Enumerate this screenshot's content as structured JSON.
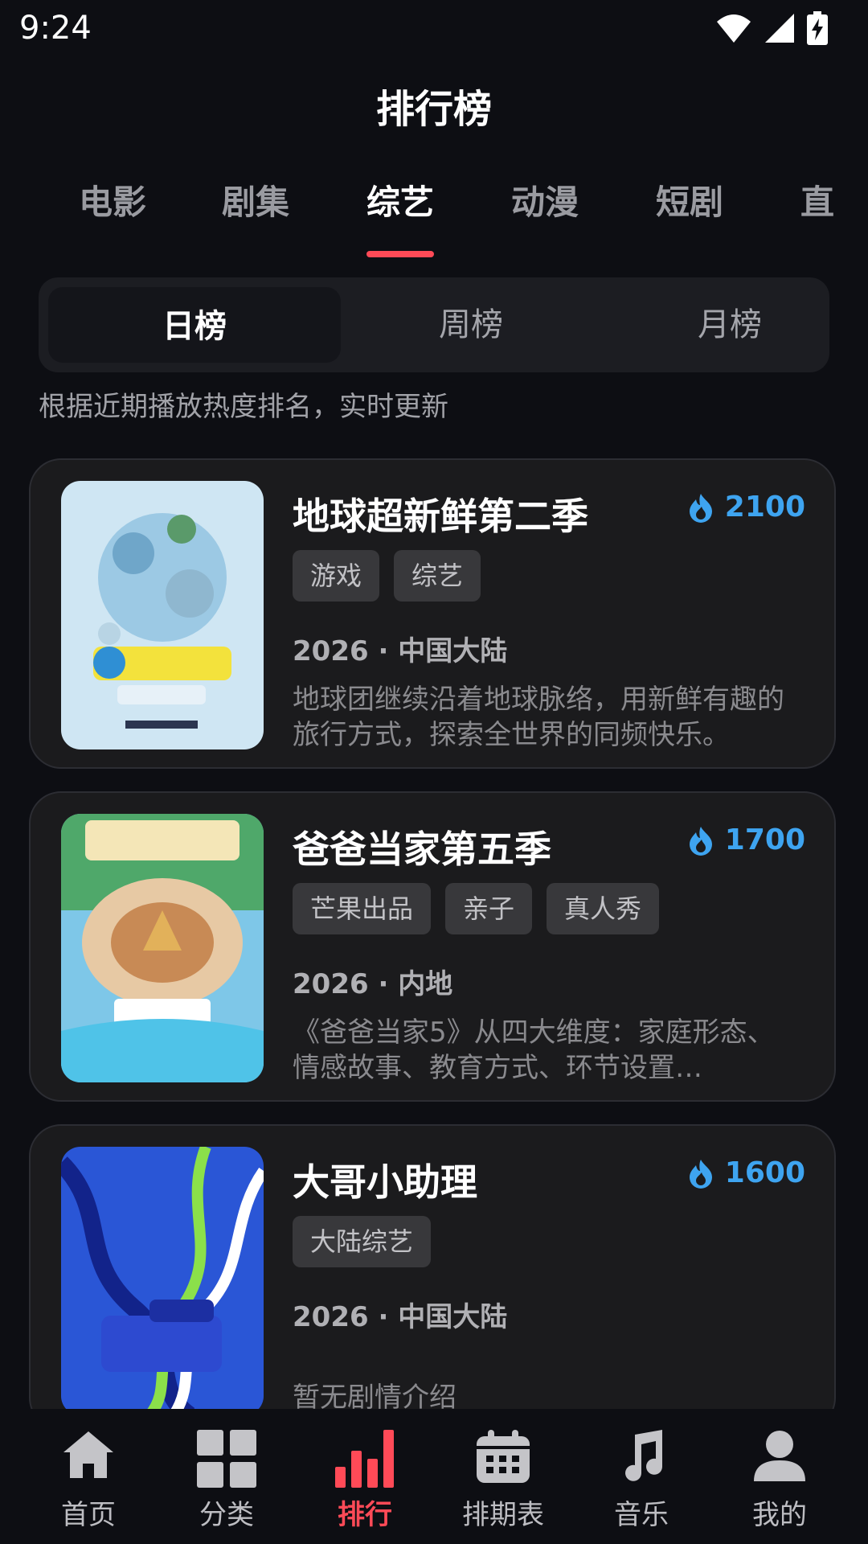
{
  "status": {
    "time": "9:24"
  },
  "header": {
    "title": "排行榜"
  },
  "tabs": [
    {
      "label": "电影"
    },
    {
      "label": "剧集"
    },
    {
      "label": "综艺",
      "active": true
    },
    {
      "label": "动漫"
    },
    {
      "label": "短剧"
    },
    {
      "label": "直"
    }
  ],
  "period": {
    "options": [
      "日榜",
      "周榜",
      "月榜"
    ],
    "selected": "日榜"
  },
  "hint": "根据近期播放热度排名，实时更新",
  "items": [
    {
      "title": "地球超新鲜第二季",
      "heat": "2100",
      "tags": [
        "游戏",
        "综艺"
      ],
      "meta": "2026 · 中国大陆",
      "desc": "地球团继续沿着地球脉络，用新鲜有趣的旅行方式，探索全世界的同频快乐。"
    },
    {
      "title": "爸爸当家第五季",
      "heat": "1700",
      "tags": [
        "芒果出品",
        "亲子",
        "真人秀"
      ],
      "meta": "2026 · 内地",
      "desc": "《爸爸当家5》从四大维度：家庭形态、情感故事、教育方式、环节设置…"
    },
    {
      "title": "大哥小助理",
      "heat": "1600",
      "tags": [
        "大陆综艺"
      ],
      "meta": "2026 · 中国大陆",
      "desc": "暂无剧情介绍"
    }
  ],
  "nav": [
    {
      "label": "首页",
      "icon": "home-icon"
    },
    {
      "label": "分类",
      "icon": "grid-icon"
    },
    {
      "label": "排行",
      "icon": "bar-chart-icon",
      "active": true
    },
    {
      "label": "排期表",
      "icon": "calendar-icon"
    },
    {
      "label": "音乐",
      "icon": "music-note-icon"
    },
    {
      "label": "我的",
      "icon": "user-icon"
    }
  ],
  "colors": {
    "accent": "#ff4a57",
    "heat": "#3ea4f0",
    "background": "#0d0e13"
  }
}
